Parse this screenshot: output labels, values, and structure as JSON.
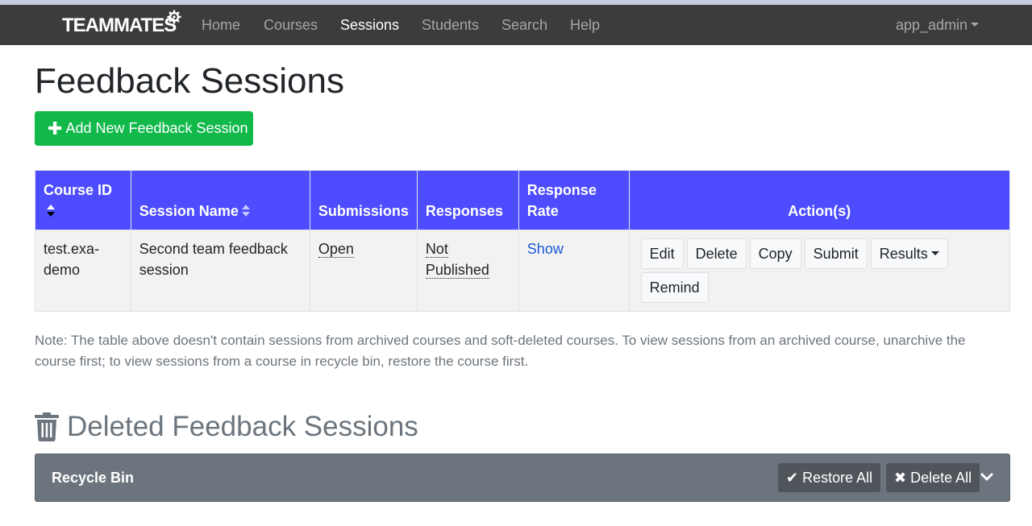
{
  "navbar": {
    "brand": "TEAMMATES",
    "links": [
      "Home",
      "Courses",
      "Sessions",
      "Students",
      "Search",
      "Help"
    ],
    "active": "Sessions",
    "user": "app_admin"
  },
  "page": {
    "title": "Feedback Sessions",
    "add_button": "Add New Feedback Session"
  },
  "table": {
    "headers": {
      "course_id": "Course ID",
      "session_name": "Session Name",
      "submissions": "Submissions",
      "responses": "Responses",
      "response_rate": "Response Rate",
      "actions": "Action(s)"
    },
    "rows": [
      {
        "course_id": "test.exa-demo",
        "session_name": "Second team feedback session",
        "submissions": "Open",
        "responses": "Not Published",
        "response_rate": "Show",
        "actions": [
          "Edit",
          "Delete",
          "Copy",
          "Submit",
          "Results",
          "Remind"
        ]
      }
    ]
  },
  "note": "Note: The table above doesn't contain sessions from archived courses and soft-deleted courses. To view sessions from an archived course, unarchive the course first; to view sessions from a course in recycle bin, restore the course first.",
  "deleted": {
    "title": "Deleted Feedback Sessions",
    "panel_title": "Recycle Bin",
    "restore_all": "Restore All",
    "delete_all": "Delete All"
  },
  "icons": {
    "brand_gear": "gear-icon",
    "plus": "plus-icon",
    "trash": "trash-icon",
    "check": "check-icon",
    "times": "times-icon",
    "chevron": "chevron-down-icon"
  },
  "colors": {
    "navbar": "#3c3c3c",
    "add_button": "#10b94a",
    "table_header": "#4d4dff",
    "recycle_panel": "#6c757d",
    "link": "#1a5ad6"
  }
}
